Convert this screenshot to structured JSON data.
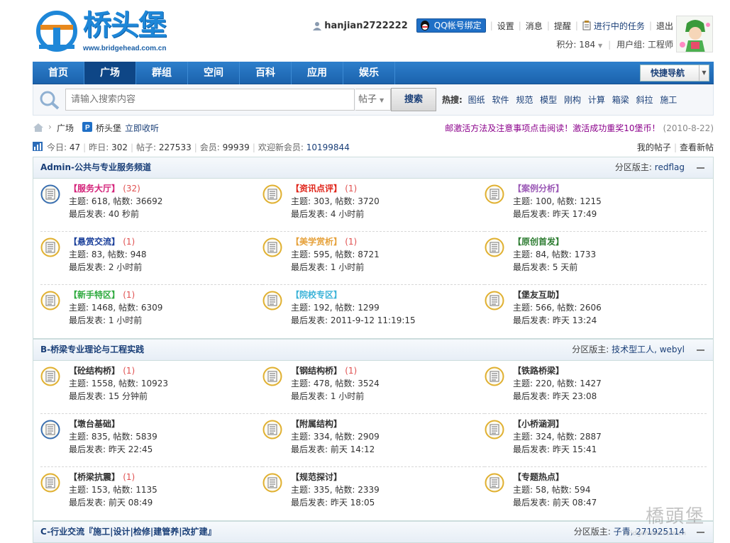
{
  "brand": {
    "name": "桥头堡",
    "url_text": "www.bridgehead.com.cn"
  },
  "user": {
    "name": "hanjian2722222",
    "qq_bind": "QQ帐号绑定",
    "links": [
      "设置",
      "消息",
      "提醒"
    ],
    "task_link": "进行中的任务",
    "logout": "退出",
    "points_label": "积分: 184",
    "group_label": "用户组: 工程师"
  },
  "nav": {
    "items": [
      "首页",
      "广场",
      "群组",
      "空间",
      "百科",
      "应用",
      "娱乐"
    ],
    "active": "广场",
    "quick_nav": "快捷导航"
  },
  "search": {
    "placeholder": "请输入搜索内容",
    "type": "帖子",
    "button": "搜索",
    "hot_label": "热搜:",
    "hot_words": [
      "图纸",
      "软件",
      "规范",
      "模型",
      "刚构",
      "计算",
      "箱梁",
      "斜拉",
      "施工"
    ]
  },
  "breadcrumb": {
    "current": "广场",
    "site": "桥头堡",
    "bookmark": "立即收听",
    "notice": "邮激活方法及注意事项点击阅读！激活成功重奖10堡币！",
    "notice_date": "(2010-8-22)"
  },
  "stats": {
    "today_label": "今日:",
    "today": "47",
    "yesterday_label": "昨日:",
    "yesterday": "302",
    "posts_label": "帖子:",
    "posts": "227533",
    "members_label": "会员:",
    "members": "99939",
    "newest_label": "欢迎新会员:",
    "newest": "10199844",
    "my_posts": "我的帖子",
    "new_posts": "查看新帖"
  },
  "categories": [
    {
      "title": "Admin-公共与专业服务频道",
      "mod_label": "分区版主:",
      "mods": "redflag",
      "boards": [
        {
          "name": "【服务大厅】",
          "color": "#d4237a",
          "new": "(32)",
          "stats": "主题: 618, 帖数: 36692",
          "last": "最后发表: 40 秒前",
          "icon": "blue"
        },
        {
          "name": "【资讯点评】",
          "color": "#e0261b",
          "new": "(1)",
          "stats": "主题: 303, 帖数: 3720",
          "last": "最后发表: 4 小时前",
          "icon": "gold"
        },
        {
          "name": "【案例分析】",
          "color": "#9b59b6",
          "new": "",
          "stats": "主题: 100, 帖数: 1215",
          "last": "最后发表: 昨天 17:49",
          "icon": "gold"
        },
        {
          "name": "【悬赏交流】",
          "color": "#1a3f9a",
          "new": "(1)",
          "stats": "主题: 83, 帖数: 948",
          "last": "最后发表: 2 小时前",
          "icon": "gold"
        },
        {
          "name": "【美学赏析】",
          "color": "#e6a23c",
          "new": "(1)",
          "stats": "主题: 595, 帖数: 8721",
          "last": "最后发表: 1 小时前",
          "icon": "gold"
        },
        {
          "name": "【原创首发】",
          "color": "#2e7d32",
          "new": "",
          "stats": "主题: 84, 帖数: 1733",
          "last": "最后发表: 5 天前",
          "icon": "gold"
        },
        {
          "name": "【新手特区】",
          "color": "#2eaa3e",
          "new": "(1)",
          "stats": "主题: 1468, 帖数: 6309",
          "last": "最后发表: 1 小时前",
          "icon": "gold"
        },
        {
          "name": "【院校专区】",
          "color": "#3cb3d8",
          "new": "",
          "stats": "主题: 192, 帖数: 1299",
          "last": "最后发表: 2011-9-12 11:19:15",
          "icon": "gold"
        },
        {
          "name": "【堡友互助】",
          "color": "#333333",
          "new": "",
          "stats": "主题: 566, 帖数: 2606",
          "last": "最后发表: 昨天 13:24",
          "icon": "gold"
        }
      ]
    },
    {
      "title": "B-桥梁专业理论与工程实践",
      "mod_label": "分区版主:",
      "mods": "技术型工人, webyl",
      "boards": [
        {
          "name": "【砼结构桥】",
          "color": "#333333",
          "new": "(1)",
          "stats": "主题: 1558, 帖数: 10923",
          "last": "最后发表: 15 分钟前",
          "icon": "gold"
        },
        {
          "name": "【钢结构桥】",
          "color": "#333333",
          "new": "(1)",
          "stats": "主题: 478, 帖数: 3524",
          "last": "最后发表: 1 小时前",
          "icon": "gold"
        },
        {
          "name": "【铁路桥梁】",
          "color": "#333333",
          "new": "",
          "stats": "主题: 220, 帖数: 1427",
          "last": "最后发表: 昨天 23:08",
          "icon": "gold"
        },
        {
          "name": "【墩台基础】",
          "color": "#333333",
          "new": "",
          "stats": "主题: 835, 帖数: 5839",
          "last": "最后发表: 昨天 22:45",
          "icon": "blue"
        },
        {
          "name": "【附属结构】",
          "color": "#333333",
          "new": "",
          "stats": "主题: 334, 帖数: 2909",
          "last": "最后发表: 前天 14:12",
          "icon": "gold"
        },
        {
          "name": "【小桥涵洞】",
          "color": "#333333",
          "new": "",
          "stats": "主题: 324, 帖数: 2887",
          "last": "最后发表: 昨天 15:41",
          "icon": "gold"
        },
        {
          "name": "【桥梁抗震】",
          "color": "#333333",
          "new": "(1)",
          "stats": "主题: 153, 帖数: 1135",
          "last": "最后发表: 前天 08:49",
          "icon": "gold"
        },
        {
          "name": "【规范探讨】",
          "color": "#333333",
          "new": "",
          "stats": "主题: 335, 帖数: 2339",
          "last": "最后发表: 昨天 18:05",
          "icon": "gold"
        },
        {
          "name": "【专题热点】",
          "color": "#333333",
          "new": "",
          "stats": "主题: 58, 帖数: 594",
          "last": "最后发表: 前天 08:47",
          "icon": "gold"
        }
      ]
    },
    {
      "title": "C-行业交流『施工|设计|检修|建管养|改扩建』",
      "mod_label": "分区版主:",
      "mods": "子青, 271925114",
      "boards": []
    }
  ],
  "watermark": {
    "text": "橋頭堡",
    "url": "bridgehead.com.cn"
  }
}
